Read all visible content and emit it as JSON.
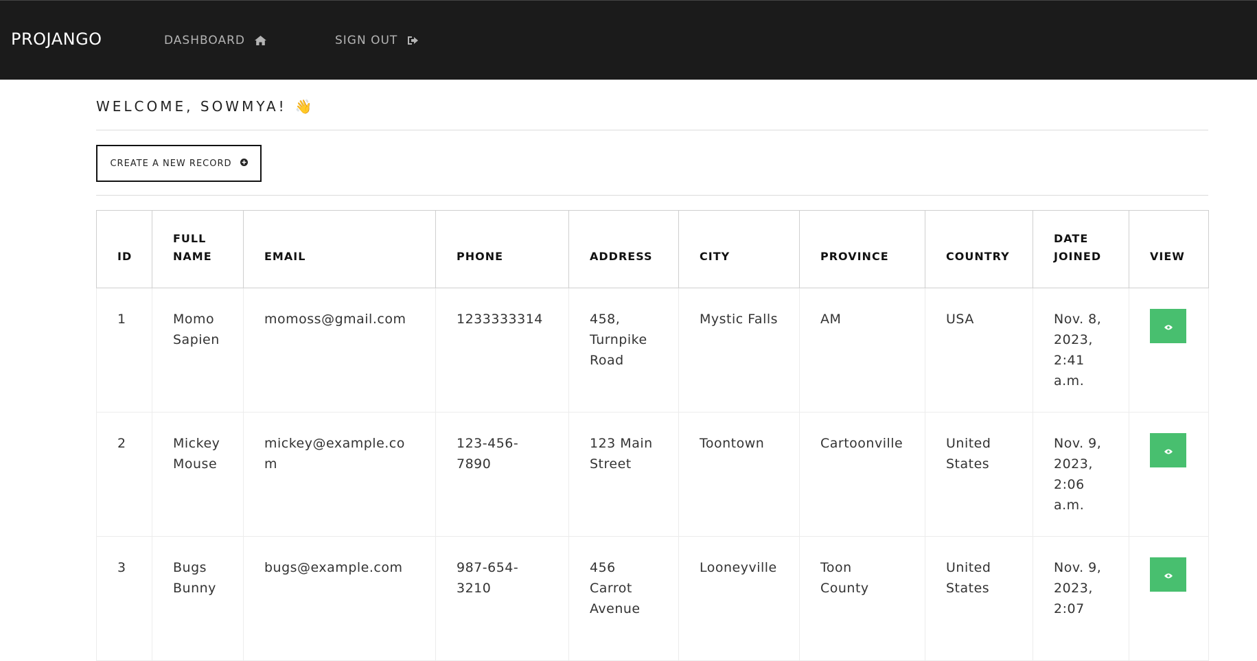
{
  "navbar": {
    "brand": "PROJANGO",
    "dashboard_label": "DASHBOARD",
    "signout_label": "SIGN OUT"
  },
  "welcome": {
    "text": "WELCOME, SOWMYA!",
    "emoji": "👋"
  },
  "create_button": {
    "label": "CREATE A NEW RECORD"
  },
  "table": {
    "headers": {
      "id": "ID",
      "full_name_1": "FULL",
      "full_name_2": "NAME",
      "email": "EMAIL",
      "phone": "PHONE",
      "address": "ADDRESS",
      "city": "CITY",
      "province": "PROVINCE",
      "country": "COUNTRY",
      "date_joined_1": "DATE",
      "date_joined_2": "JOINED",
      "view": "VIEW"
    },
    "rows": [
      {
        "id": "1",
        "full_name": "Momo Sapien",
        "email": "momoss@gmail.com",
        "phone": "1233333314",
        "address": "458, Turnpike Road",
        "city": "Mystic Falls",
        "province": "AM",
        "country": "USA",
        "date_joined": "Nov. 8, 2023, 2:41 a.m."
      },
      {
        "id": "2",
        "full_name": "Mickey Mouse",
        "email": "mickey@example.com",
        "phone": "123-456-7890",
        "address": "123 Main Street",
        "city": "Toontown",
        "province": "Cartoonville",
        "country": "United States",
        "date_joined": "Nov. 9, 2023, 2:06 a.m."
      },
      {
        "id": "3",
        "full_name": "Bugs Bunny",
        "email": "bugs@example.com",
        "phone": "987-654-3210",
        "address": "456 Carrot Avenue",
        "city": "Looneyville",
        "province": "Toon County",
        "country": "United States",
        "date_joined": "Nov. 9, 2023, 2:07"
      }
    ]
  },
  "colors": {
    "navbar_bg": "#1b1b1b",
    "view_button": "#48bf6f"
  },
  "icons": {
    "dashboard": "home-icon",
    "signout": "sign-out-icon",
    "create": "plus-circle-icon",
    "view": "eye-icon"
  }
}
